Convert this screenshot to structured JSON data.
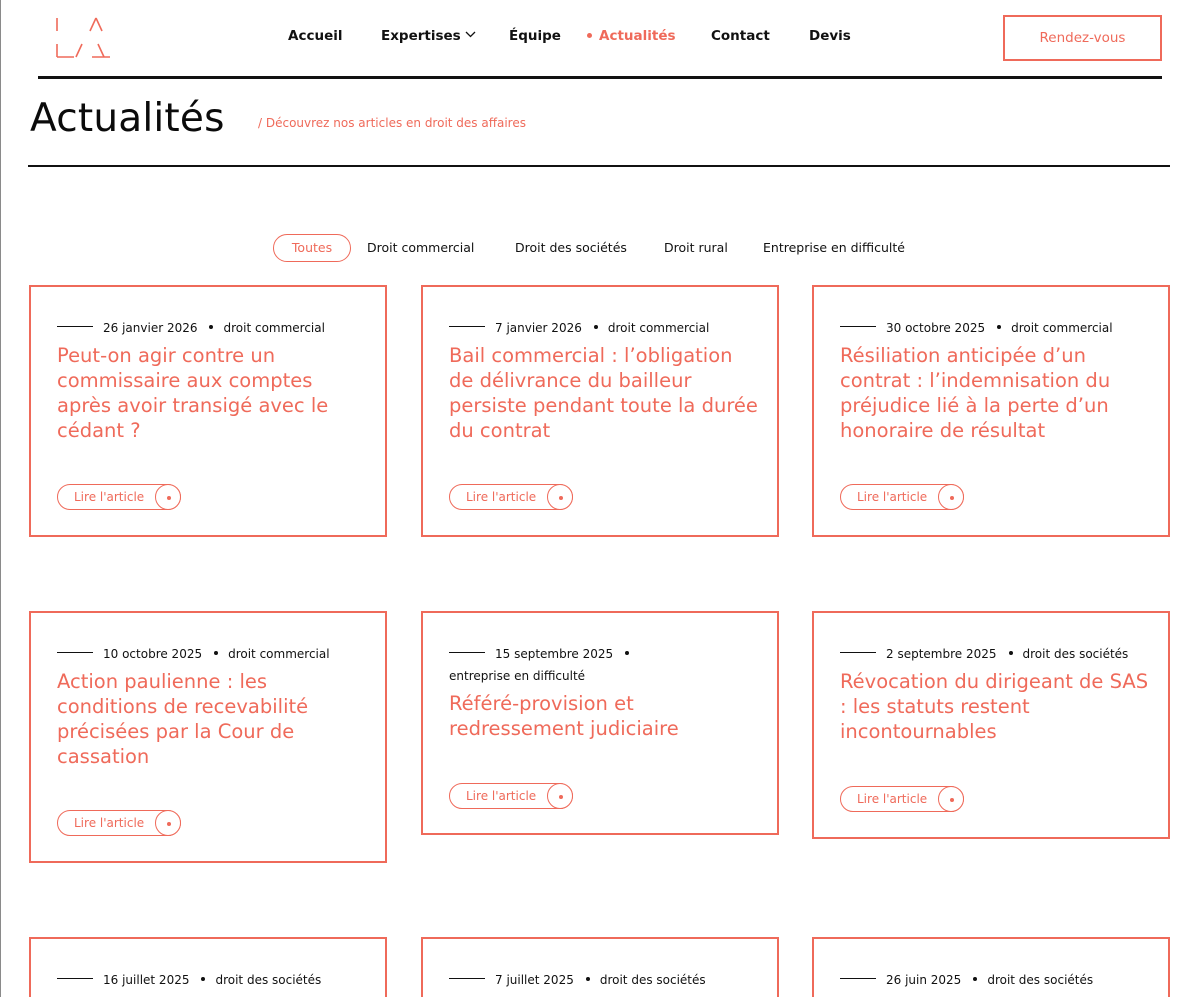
{
  "colors": {
    "accent": "#ef6a5a",
    "text": "#111111",
    "background": "#ffffff"
  },
  "logo": {
    "icon": "la-triangle-logo-icon"
  },
  "nav": {
    "items": [
      {
        "label": "Accueil"
      },
      {
        "label": "Expertises",
        "icon": "chevron-down-icon"
      },
      {
        "label": "Équipe"
      },
      {
        "label": "Actualités",
        "active": true
      },
      {
        "label": "Contact"
      },
      {
        "label": "Devis"
      }
    ],
    "cta": "Rendez-vous"
  },
  "page": {
    "title": "Actualités",
    "subtitle": "/ Découvrez nos articles en droit des affaires"
  },
  "filters": [
    {
      "label": "Toutes",
      "active": true
    },
    {
      "label": "Droit commercial"
    },
    {
      "label": "Droit des sociétés"
    },
    {
      "label": "Droit rural"
    },
    {
      "label": "Entreprise en difficulté"
    }
  ],
  "read_label": "Lire l'article",
  "articles": [
    {
      "date": "26 janvier 2026",
      "category": "droit commercial",
      "title": "Peut-on agir contre un commissaire aux comptes après avoir transigé avec le cédant ?"
    },
    {
      "date": "7 janvier 2026",
      "category": "droit commercial",
      "title": "Bail commercial : l’obligation de délivrance du bailleur persiste pendant toute la durée du contrat"
    },
    {
      "date": "30 octobre 2025",
      "category": "droit commercial",
      "title": "Résiliation anticipée d’un contrat : l’indemnisation du préjudice lié à la perte d’un honoraire de résultat"
    },
    {
      "date": "10 octobre 2025",
      "category": "droit commercial",
      "title": "Action paulienne : les conditions de recevabilité précisées par la Cour de cassation"
    },
    {
      "date": "15 septembre 2025",
      "category": "entreprise en difficulté",
      "title": "Référé-provision et redressement judiciaire"
    },
    {
      "date": "2 septembre 2025",
      "category": "droit des sociétés",
      "title": "Révocation du dirigeant de SAS : les statuts restent incontournables"
    },
    {
      "date": "16 juillet 2025",
      "category": "droit des sociétés",
      "title": ""
    },
    {
      "date": "7 juillet 2025",
      "category": "droit des sociétés",
      "title": ""
    },
    {
      "date": "26 juin 2025",
      "category": "droit des sociétés",
      "title": ""
    }
  ]
}
